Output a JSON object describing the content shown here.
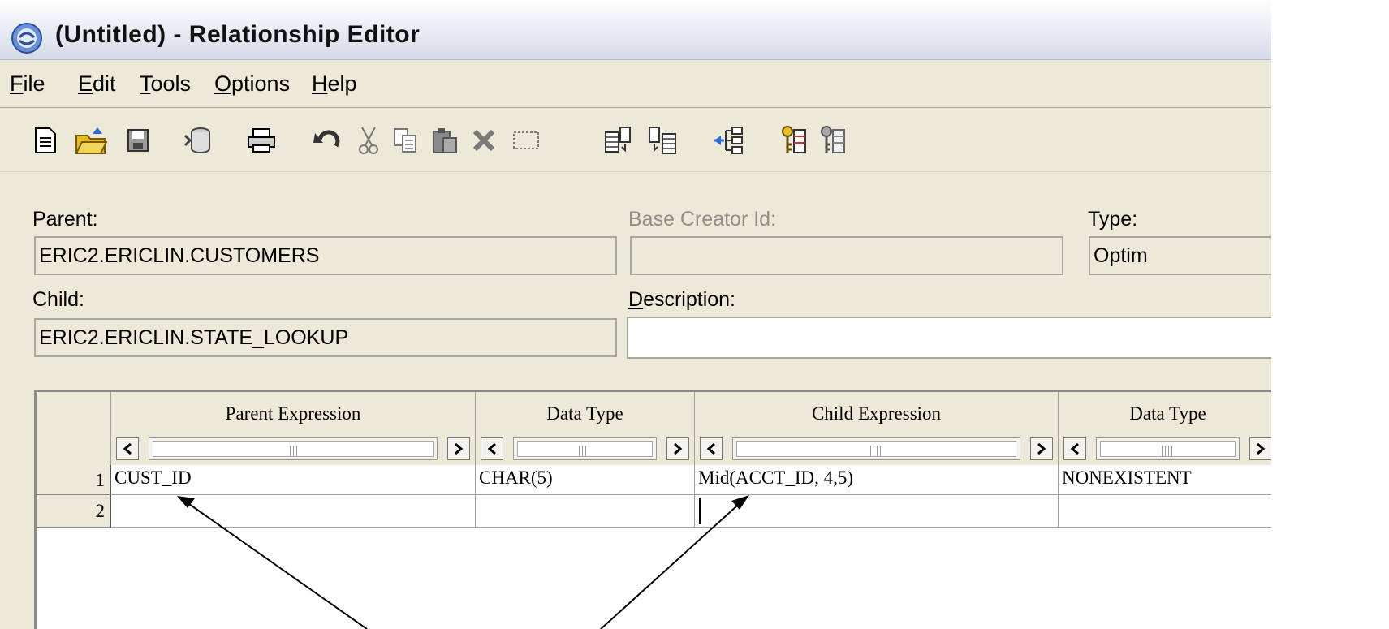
{
  "window": {
    "title": "(Untitled) - Relationship Editor"
  },
  "menu": [
    {
      "label": "File",
      "key": "F",
      "rest": "ile"
    },
    {
      "label": "Edit",
      "key": "E",
      "rest": "dit"
    },
    {
      "label": "Tools",
      "key": "T",
      "rest": "ools"
    },
    {
      "label": "Options",
      "key": "O",
      "rest": "ptions"
    },
    {
      "label": "Help",
      "key": "H",
      "rest": "elp"
    }
  ],
  "toolbar": {
    "icons": [
      "new-icon",
      "open-icon",
      "save-icon",
      "database-icon",
      "print-icon",
      "undo-icon",
      "cut-icon",
      "copy-icon",
      "paste-icon",
      "delete-icon",
      "select-all-icon",
      "parent-table-icon",
      "child-table-icon",
      "hierarchy-icon",
      "key-icon",
      "key-list-icon"
    ]
  },
  "form": {
    "parent_label": "Parent:",
    "parent_value": "ERIC2.ERICLIN.CUSTOMERS",
    "base_creator_label": "Base Creator Id:",
    "base_creator_value": "",
    "type_label": "Type:",
    "type_value": "Optim",
    "child_label": "Child:",
    "child_value": "ERIC2.ERICLIN.STATE_LOOKUP",
    "description_label_key": "D",
    "description_label_rest": "escription:",
    "description_value": ""
  },
  "grid": {
    "columns": [
      "Parent Expression",
      "Data Type",
      "Child Expression",
      "Data Type"
    ],
    "rows": [
      {
        "num": "1",
        "parent_expr": "CUST_ID",
        "parent_type": "CHAR(5)",
        "child_expr": "Mid(ACCT_ID, 4,5)",
        "child_type": "NONEXISTENT"
      },
      {
        "num": "2",
        "parent_expr": "",
        "parent_type": "",
        "child_expr": "",
        "child_type": ""
      }
    ]
  },
  "colors": {
    "window_bg": "#ece9d8",
    "annotation_arrow": "#000000"
  }
}
